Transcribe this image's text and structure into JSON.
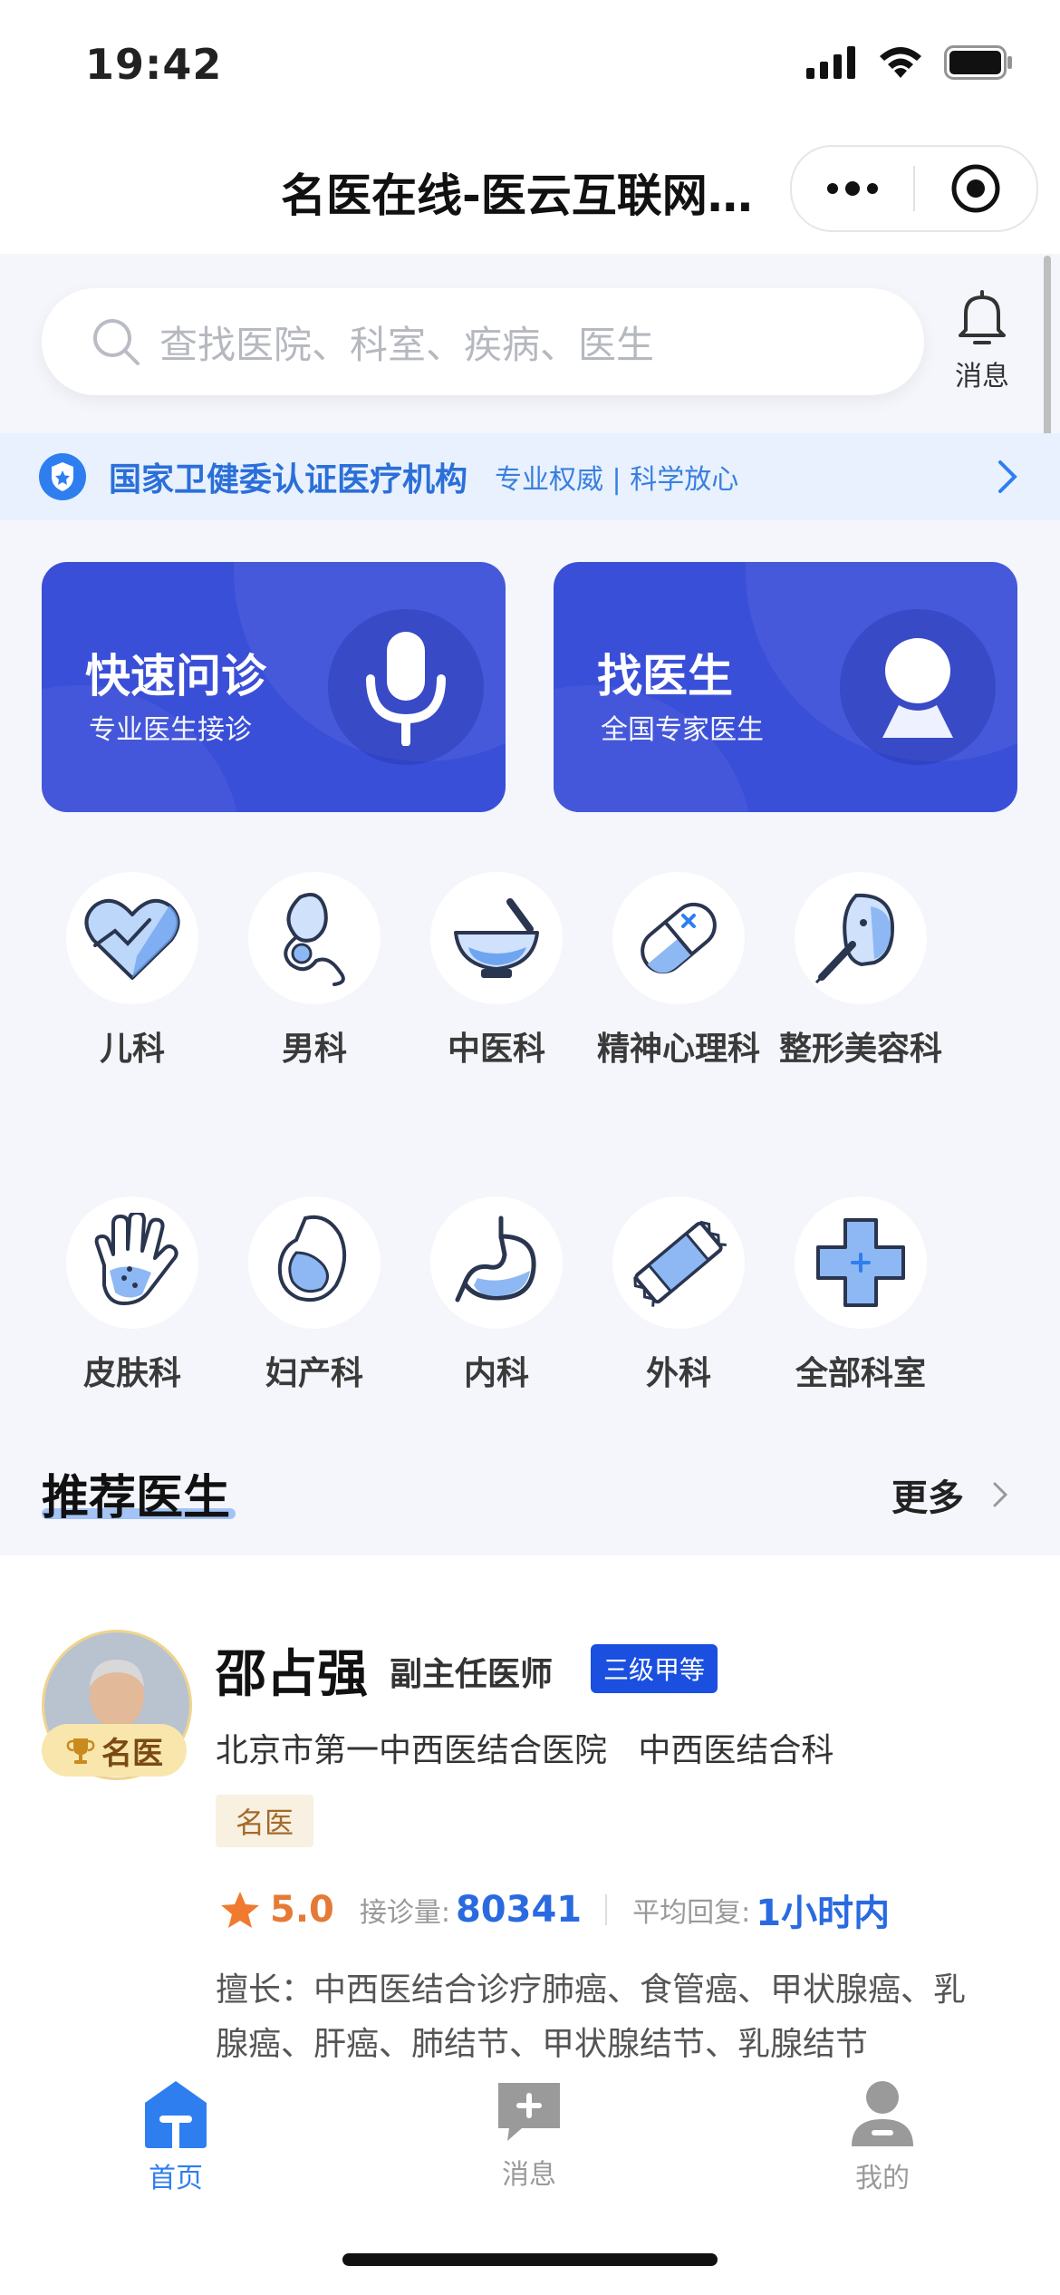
{
  "status": {
    "time": "19:42"
  },
  "nav": {
    "title": "名医在线-医云互联网…"
  },
  "search": {
    "placeholder": "查找医院、科室、疾病、医生",
    "message_label": "消息"
  },
  "banner": {
    "main": "国家卫健委认证医疗机构",
    "sub": "专业权威 | 科学放心"
  },
  "cards": [
    {
      "title": "快速问诊",
      "subtitle": "专业医生接诊",
      "icon": "microphone-icon"
    },
    {
      "title": "找医生",
      "subtitle": "全国专家医生",
      "icon": "doctor-avatar-icon"
    }
  ],
  "departments_row1": [
    {
      "label": "儿科",
      "icon": "heart-icon"
    },
    {
      "label": "男科",
      "icon": "male-organ-icon"
    },
    {
      "label": "中医科",
      "icon": "mortar-icon"
    },
    {
      "label": "精神心理科",
      "icon": "pill-icon"
    },
    {
      "label": "整形美容科",
      "icon": "face-syringe-icon"
    }
  ],
  "departments_row2": [
    {
      "label": "皮肤科",
      "icon": "hand-icon"
    },
    {
      "label": "妇产科",
      "icon": "pregnant-icon"
    },
    {
      "label": "内科",
      "icon": "stomach-icon"
    },
    {
      "label": "外科",
      "icon": "bandage-icon"
    },
    {
      "label": "全部科室",
      "icon": "medical-cross-icon"
    }
  ],
  "recommend": {
    "title": "推荐医生",
    "more": "更多"
  },
  "doctor": {
    "name": "邵占强",
    "title": "副主任医师",
    "level": "三级甲等",
    "badge": "名医",
    "hospital": "北京市第一中西医结合医院   中西医结合科",
    "tag": "名医",
    "rating": "5.0",
    "consult_label": "接诊量:",
    "consult_value": "80341",
    "reply_label": "平均回复:",
    "reply_value": "1小时内",
    "specialty": "擅长：中西医结合诊疗肺癌、食管癌、甲状腺癌、乳腺癌、肝癌、肺结节、甲状腺结节、乳腺结节"
  },
  "tabbar": [
    {
      "label": "首页",
      "active": true
    },
    {
      "label": "消息",
      "active": false
    },
    {
      "label": "我的",
      "active": false
    }
  ],
  "colors": {
    "primary": "#3a4fd8",
    "accent_blue": "#2b6fd9",
    "orange": "#e57a36",
    "tab_active": "#2f7ef0",
    "tab_inactive": "#9a9a9a"
  }
}
